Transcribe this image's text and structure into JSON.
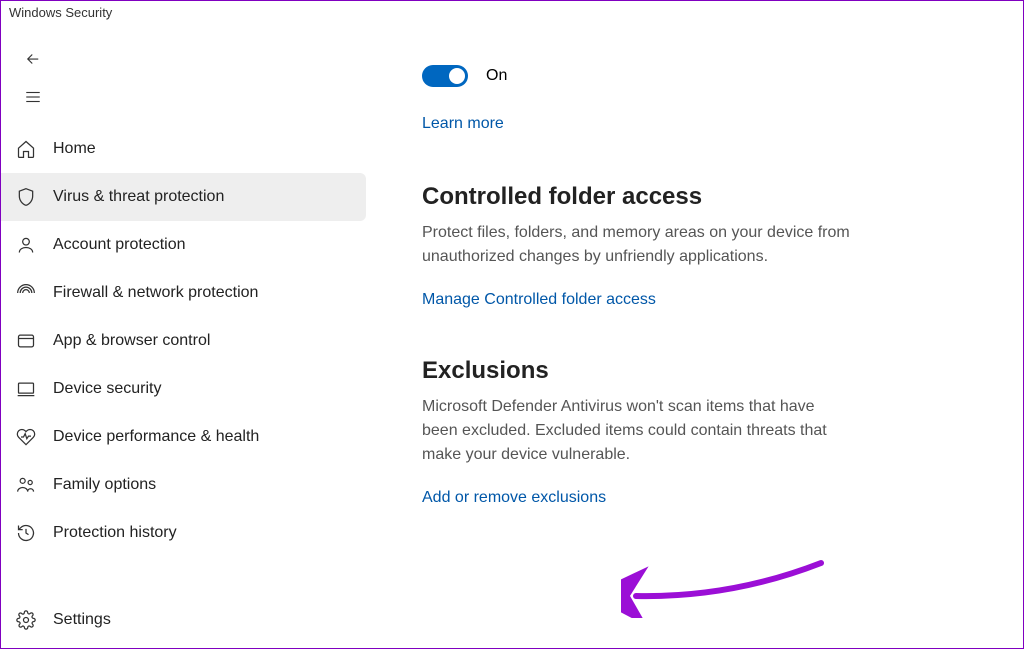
{
  "window": {
    "title": "Windows Security"
  },
  "sidebar": {
    "items": [
      {
        "label": "Home"
      },
      {
        "label": "Virus & threat protection"
      },
      {
        "label": "Account protection"
      },
      {
        "label": "Firewall & network protection"
      },
      {
        "label": "App & browser control"
      },
      {
        "label": "Device security"
      },
      {
        "label": "Device performance & health"
      },
      {
        "label": "Family options"
      },
      {
        "label": "Protection history"
      }
    ],
    "settings_label": "Settings"
  },
  "main": {
    "toggle": {
      "state": "On"
    },
    "learn_more": "Learn more",
    "controlled_folder": {
      "heading": "Controlled folder access",
      "description": "Protect files, folders, and memory areas on your device from unauthorized changes by unfriendly applications.",
      "link": "Manage Controlled folder access"
    },
    "exclusions": {
      "heading": "Exclusions",
      "description": "Microsoft Defender Antivirus won't scan items that have been excluded. Excluded items could contain threats that make your device vulnerable.",
      "link": "Add or remove exclusions"
    }
  }
}
